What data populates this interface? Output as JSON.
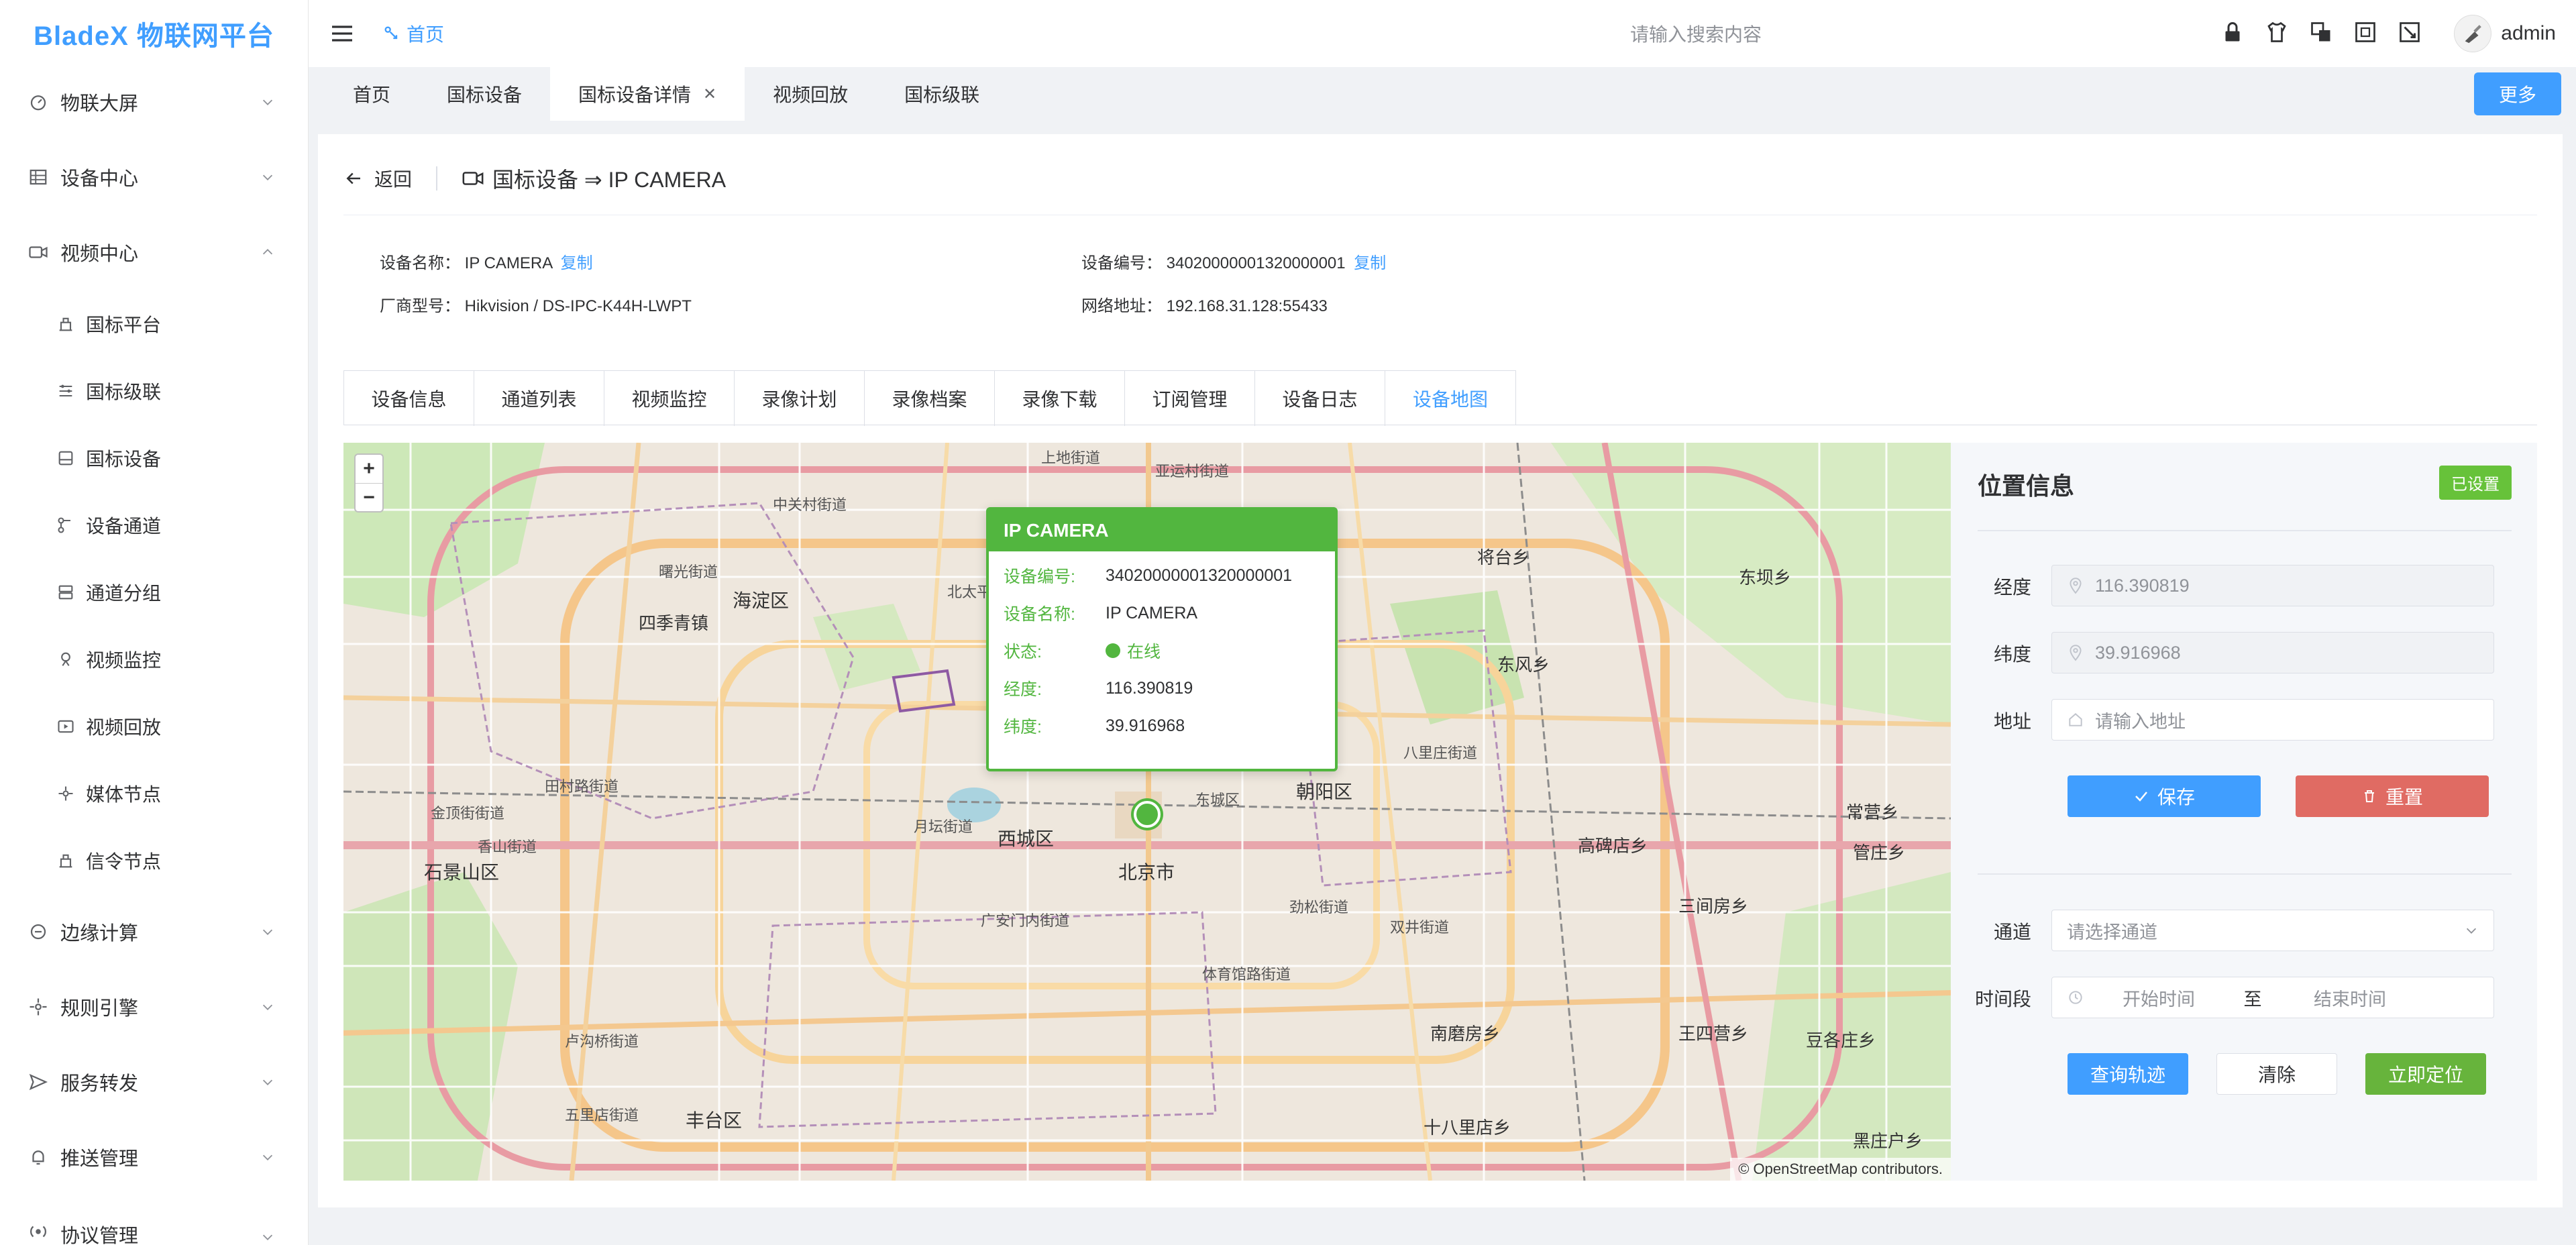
{
  "app": {
    "title": "BladeX 物联网平台"
  },
  "sidebar": {
    "items": [
      {
        "label": "物联大屏",
        "icon": "dashboard-icon"
      },
      {
        "label": "设备中心",
        "icon": "device-icon"
      },
      {
        "label": "视频中心",
        "icon": "video-icon",
        "expanded": true
      },
      {
        "label": "边缘计算",
        "icon": "edge-icon"
      },
      {
        "label": "规则引擎",
        "icon": "rule-icon"
      },
      {
        "label": "服务转发",
        "icon": "forward-icon"
      },
      {
        "label": "推送管理",
        "icon": "bell-icon"
      },
      {
        "label": "协议管理",
        "icon": "protocol-icon"
      }
    ],
    "video_children": [
      {
        "label": "国标平台",
        "icon": "platform-icon"
      },
      {
        "label": "国标级联",
        "icon": "cascade-icon"
      },
      {
        "label": "国标设备",
        "icon": "gb-device-icon"
      },
      {
        "label": "设备通道",
        "icon": "channel-icon"
      },
      {
        "label": "通道分组",
        "icon": "group-icon"
      },
      {
        "label": "视频监控",
        "icon": "monitor-icon"
      },
      {
        "label": "视频回放",
        "icon": "playback-icon"
      },
      {
        "label": "媒体节点",
        "icon": "media-node-icon"
      },
      {
        "label": "信令节点",
        "icon": "signal-node-icon"
      }
    ]
  },
  "header": {
    "breadcrumb": "首页",
    "search_placeholder": "请输入搜索内容",
    "user": "admin"
  },
  "tabs": [
    {
      "label": "首页"
    },
    {
      "label": "国标设备"
    },
    {
      "label": "国标设备详情",
      "active": true
    },
    {
      "label": "视频回放"
    },
    {
      "label": "国标级联"
    }
  ],
  "more_label": "更多",
  "page": {
    "back_label": "返回",
    "title": "国标设备 ⇒ IP CAMERA"
  },
  "device": {
    "name_label": "设备名称：",
    "name": "IP CAMERA",
    "copy": "复制",
    "code_label": "设备编号：",
    "code": "34020000001320000001",
    "vendor_label": "厂商型号：",
    "vendor": "Hikvision / DS-IPC-K44H-LWPT",
    "address_label": "网络地址：",
    "address": "192.168.31.128:55433"
  },
  "detail_tabs": [
    {
      "label": "设备信息"
    },
    {
      "label": "通道列表"
    },
    {
      "label": "视频监控"
    },
    {
      "label": "录像计划"
    },
    {
      "label": "录像档案"
    },
    {
      "label": "录像下载"
    },
    {
      "label": "订阅管理"
    },
    {
      "label": "设备日志"
    },
    {
      "label": "设备地图",
      "active": true
    }
  ],
  "map": {
    "attribution": "© OpenStreetMap contributors.",
    "zoom_in": "+",
    "zoom_out": "−",
    "labels": [
      "上地街道",
      "亚运村街道",
      "中关村街道",
      "海淀区",
      "四季青镇",
      "曙光街道",
      "北太平庄街道",
      "西城区",
      "北京市",
      "朝阳区",
      "东城区",
      "石景山区",
      "丰台区",
      "南磨房乡",
      "三间房乡",
      "八里庄街道",
      "双井街道",
      "十八里店乡",
      "王四营乡",
      "东坝乡",
      "将台乡",
      "常营乡",
      "豆各庄乡",
      "黑庄户乡",
      "卢沟桥街道",
      "五里店街道",
      "东风乡",
      "月坛街道",
      "广安门内街道",
      "体育馆路街道",
      "劲松街道",
      "高碑店乡",
      "管庄乡",
      "香山街道",
      "田村路街道",
      "金顶街街道"
    ],
    "popup": {
      "title": "IP CAMERA",
      "rows": {
        "code_label": "设备编号:",
        "code": "34020000001320000001",
        "name_label": "设备名称:",
        "name": "IP CAMERA",
        "status_label": "状态:",
        "status": "在线",
        "lng_label": "经度:",
        "lng": "116.390819",
        "lat_label": "纬度:",
        "lat": "39.916968"
      }
    }
  },
  "panel": {
    "title": "位置信息",
    "badge": "已设置",
    "lng_label": "经度",
    "lng_value": "116.390819",
    "lat_label": "纬度",
    "lat_value": "39.916968",
    "addr_label": "地址",
    "addr_placeholder": "请输入地址",
    "save": "保存",
    "reset": "重置",
    "channel_label": "通道",
    "channel_placeholder": "请选择通道",
    "time_label": "时间段",
    "start_placeholder": "开始时间",
    "to": "至",
    "end_placeholder": "结束时间",
    "query": "查询轨迹",
    "clear": "清除",
    "locate": "立即定位"
  },
  "colors": {
    "primary": "#409eff",
    "success": "#67c23a",
    "danger": "#e06b63",
    "popup_green": "#52b63f"
  }
}
